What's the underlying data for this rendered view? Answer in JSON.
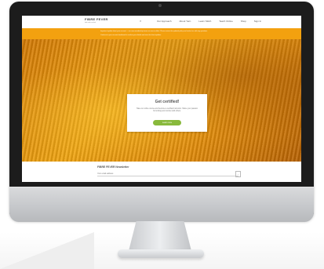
{
  "site": {
    "logo": "FIBRE FEVER",
    "logo_sub": "knit and crochet",
    "search_icon": "search-icon",
    "nav_links": [
      "Our Approach",
      "About Yarn",
      "Learn Stitch",
      "Teach Online",
      "Shop",
      "Sign In"
    ]
  },
  "banner": {
    "line1": "Important update about your account — our new membership terms are now in effect. Please review the updated policy and contact us with any questions.",
    "line2": "Continue to your account dashboard to confirm your details and view the latest updates."
  },
  "hero": {
    "card_title": "Get certified!",
    "card_text": "Take our online course and become a certified instructor. Share your passion for knitting and crochet with others.",
    "button_label": "Learn more"
  },
  "newsletter": {
    "title": "FIBRE FEVER Newsletter",
    "placeholder": "Your email address",
    "submit_icon": "arrow-right-icon"
  },
  "colors": {
    "banner": "#f3a10f",
    "button": "#88b93c",
    "hero": "#e28c0a"
  }
}
